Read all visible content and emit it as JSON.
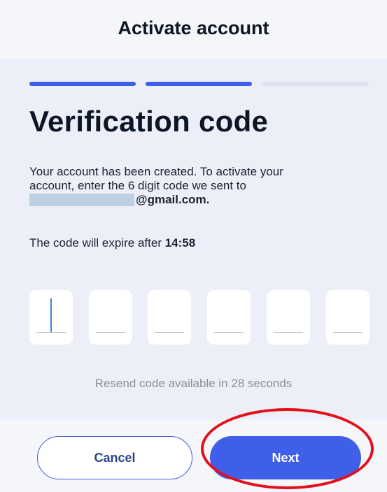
{
  "header": {
    "title": "Activate account"
  },
  "progress": {
    "steps": [
      {
        "state": "complete",
        "color": "#3f5fe8"
      },
      {
        "state": "complete",
        "color": "#3f5fe8"
      },
      {
        "state": "pending",
        "color": "#dde3f3"
      }
    ]
  },
  "main": {
    "heading": "Verification code",
    "description_line1": "Your account has been created. To activate your",
    "description_line2": "account, enter the 6 digit code we sent to",
    "email_domain": "@gmail.com.",
    "expire_prefix": "The code will expire after ",
    "expire_time": "14:58",
    "code_digits": [
      "",
      "",
      "",
      "",
      "",
      ""
    ],
    "active_digit_index": 0,
    "resend_text": "Resend code available in 28 seconds"
  },
  "footer": {
    "cancel_label": "Cancel",
    "next_label": "Next"
  },
  "colors": {
    "accent": "#3f5fe8",
    "annotation": "#e3101c",
    "caret": "#3a86e0"
  }
}
